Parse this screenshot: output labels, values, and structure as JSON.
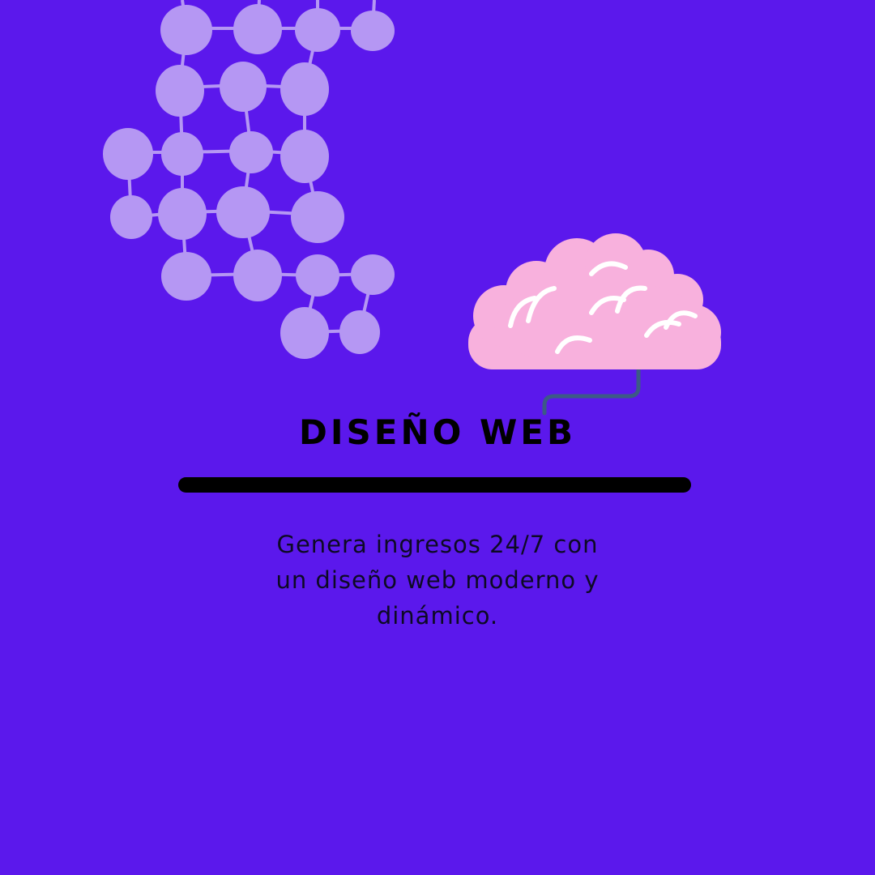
{
  "page": {
    "background_color": "#5b18ec"
  },
  "graphics": {
    "molecule_icon": "molecule-network-icon",
    "molecule_color": "#b597f3",
    "brain_icon": "brain-icon",
    "brain_color": "#f8b1dd",
    "brain_detail_color": "#ffffff",
    "cord_color": "#3c5a86"
  },
  "heading": {
    "title": "DISEÑO WEB"
  },
  "description": {
    "lines": [
      "Genera ingresos 24/7 con",
      "un diseño web moderno y",
      "dinámico."
    ]
  }
}
